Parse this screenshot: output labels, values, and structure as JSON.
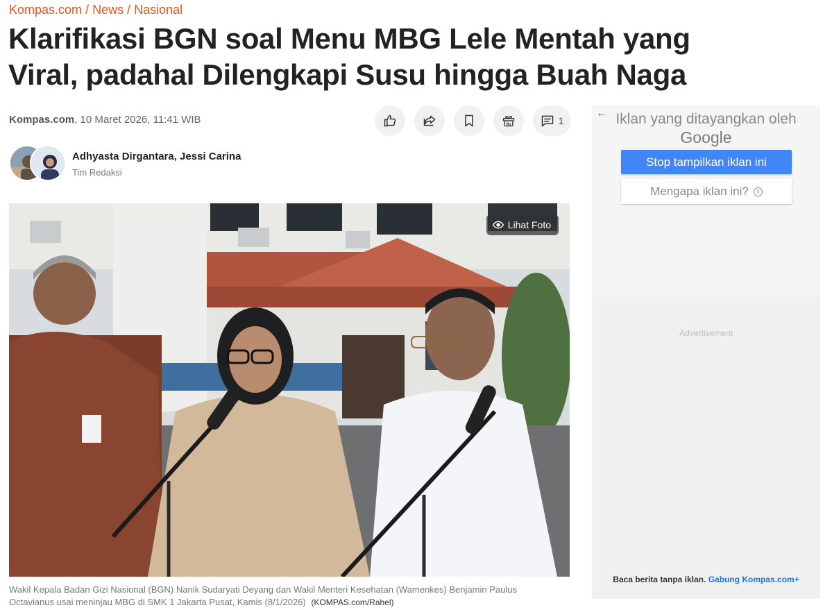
{
  "breadcrumb": {
    "items": [
      "Kompas.com",
      "News",
      "Nasional"
    ],
    "separator": "/"
  },
  "article": {
    "title": "Klarifikasi BGN soal Menu MBG Lele Mentah yang Viral, padahal Dilengkapi Susu hingga Buah Naga",
    "source": "Kompas.com",
    "datetime": ", 10 Maret 2026, 11:41 WIB",
    "authors": "Adhyasta Dirgantara,  Jessi Carina",
    "author_role": "Tim Redaksi",
    "comment_count": "1"
  },
  "actions": {
    "icons": [
      "thumbs-up-icon",
      "share-icon",
      "bookmark-icon",
      "gift-icon",
      "comment-icon"
    ]
  },
  "photo": {
    "view_label": "Lihat Foto"
  },
  "caption": {
    "text": "Wakil Kepala Badan Gizi Nasional (BGN) Nanik Sudaryati Deyang dan Wakil Menteri Kesehatan (Wamenkes) Benjamin Paulus Octavianus usai meninjau MBG di SMK 1 Jakarta Pusat, Kamis (8/1/2026)",
    "credit": "(KOMPAS.com/Rahel)"
  },
  "ad": {
    "title": "Iklan yang ditayangkan oleh",
    "brand": "Google",
    "stop_label": "Stop tampilkan iklan ini",
    "why_label": "Mengapa iklan ini?",
    "advertisement_label": "Advertisement",
    "footer_text": "Baca berita tanpa iklan.",
    "footer_link": "Gabung Kompas.com+"
  },
  "colors": {
    "accent": "#e2541f",
    "ad_button": "#4285f4",
    "link_blue": "#1a73e8"
  }
}
